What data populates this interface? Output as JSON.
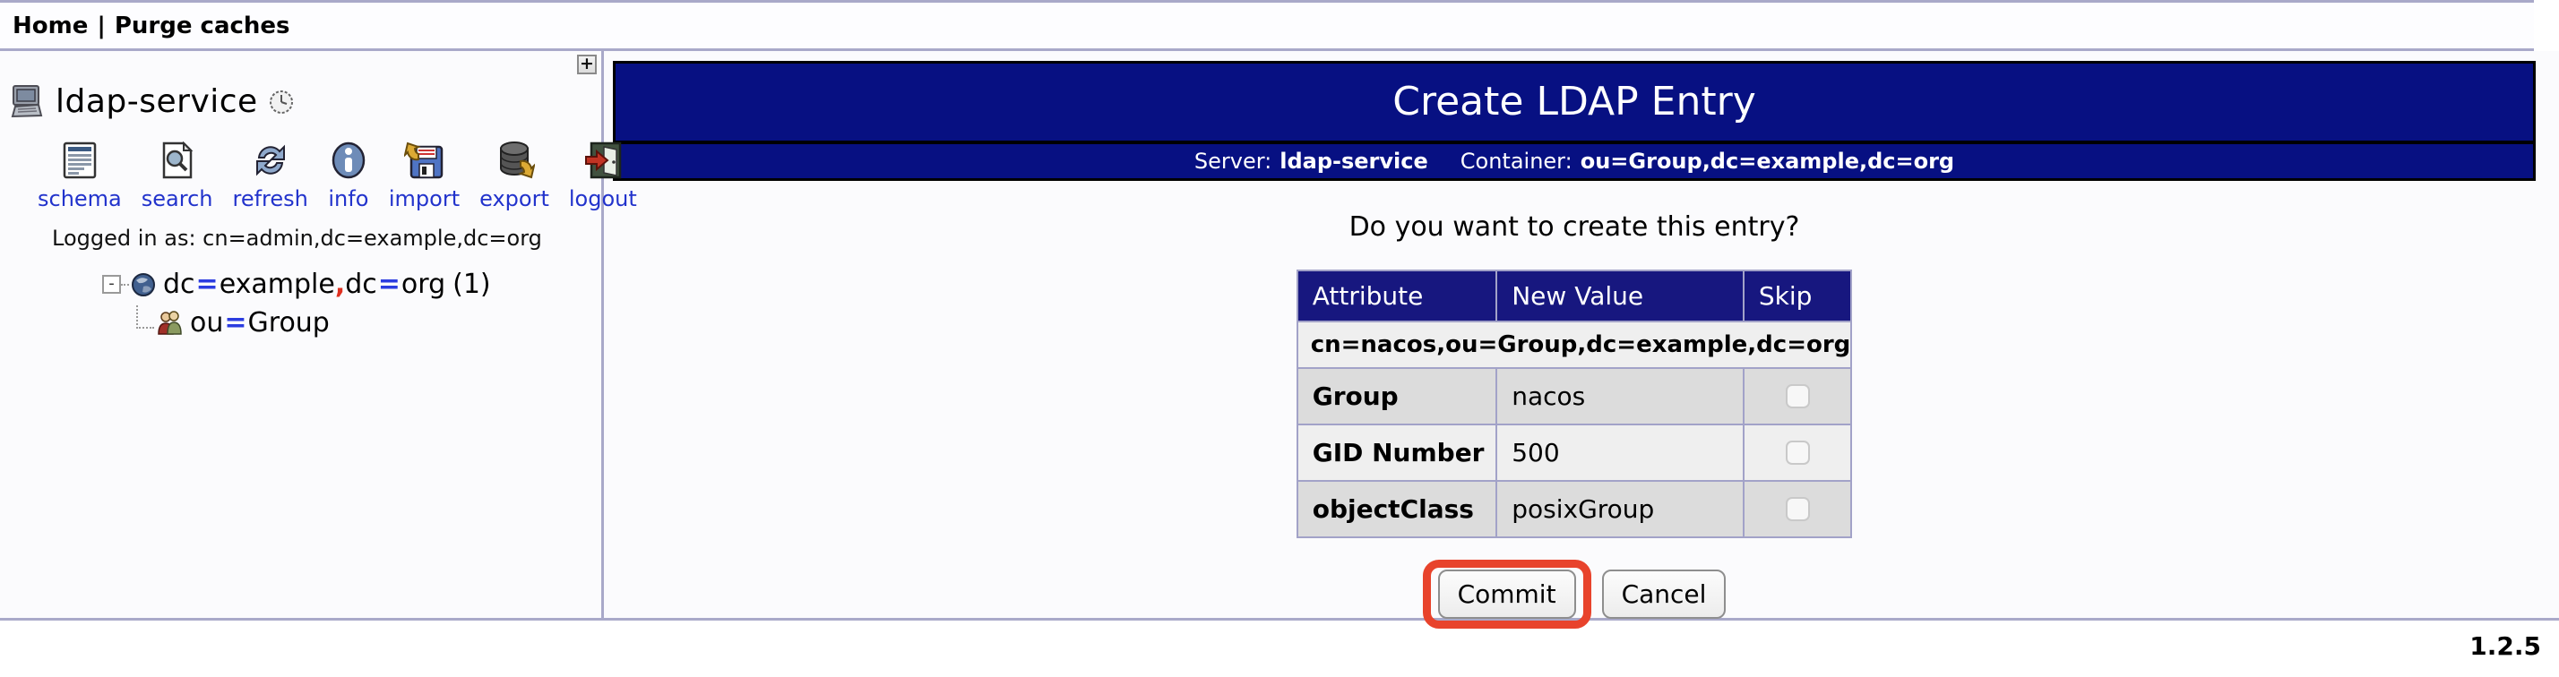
{
  "topbar": {
    "home_label": "Home",
    "separator": "|",
    "purge_label": "Purge caches"
  },
  "sidebar": {
    "server_name": "ldap-service",
    "expand_button": "+",
    "toolbar": [
      {
        "label": "schema"
      },
      {
        "label": "search"
      },
      {
        "label": "refresh"
      },
      {
        "label": "info"
      },
      {
        "label": "import"
      },
      {
        "label": "export"
      },
      {
        "label": "logout"
      }
    ],
    "logged_in_as": "Logged in as: cn=admin,dc=example,dc=org",
    "tree": {
      "root": {
        "collapse_glyph": "-",
        "parts": [
          "dc",
          "=",
          "example",
          ",",
          "dc",
          "=",
          "org",
          "(1)"
        ]
      },
      "child": {
        "parts": [
          "ou",
          "=",
          "Group"
        ]
      }
    }
  },
  "main": {
    "title": "Create LDAP Entry",
    "server_label": "Server:",
    "server_value": "ldap-service",
    "container_label": "Container:",
    "container_value": "ou=Group,dc=example,dc=org",
    "question": "Do you want to create this entry?",
    "table": {
      "headers": [
        "Attribute",
        "New Value",
        "Skip"
      ],
      "dn": "cn=nacos,ou=Group,dc=example,dc=org",
      "rows": [
        {
          "attribute": "Group",
          "value": "nacos",
          "skip": false
        },
        {
          "attribute": "GID Number",
          "value": "500",
          "skip": false
        },
        {
          "attribute": "objectClass",
          "value": "posixGroup",
          "skip": false
        }
      ]
    },
    "buttons": {
      "commit": "Commit",
      "cancel": "Cancel"
    }
  },
  "footer": {
    "version": "1.2.5"
  },
  "icons": [
    "computer-icon",
    "clock-icon",
    "schema-icon",
    "search-icon",
    "refresh-icon",
    "info-icon",
    "import-icon",
    "export-icon",
    "logout-icon",
    "globe-icon",
    "group-icon",
    "minus-box-icon",
    "plus-icon"
  ],
  "colors": {
    "banner_navy": "#071082",
    "table_header_navy": "#17177f",
    "lavender_border": "#a9a9c9",
    "highlight_red": "#e8432c",
    "link_blue": "#2233cc",
    "tree_equals_blue": "#2b3ce0",
    "tree_comma_red": "#e03020",
    "row_dark": "#dcdcdc",
    "row_light": "#efefef"
  }
}
